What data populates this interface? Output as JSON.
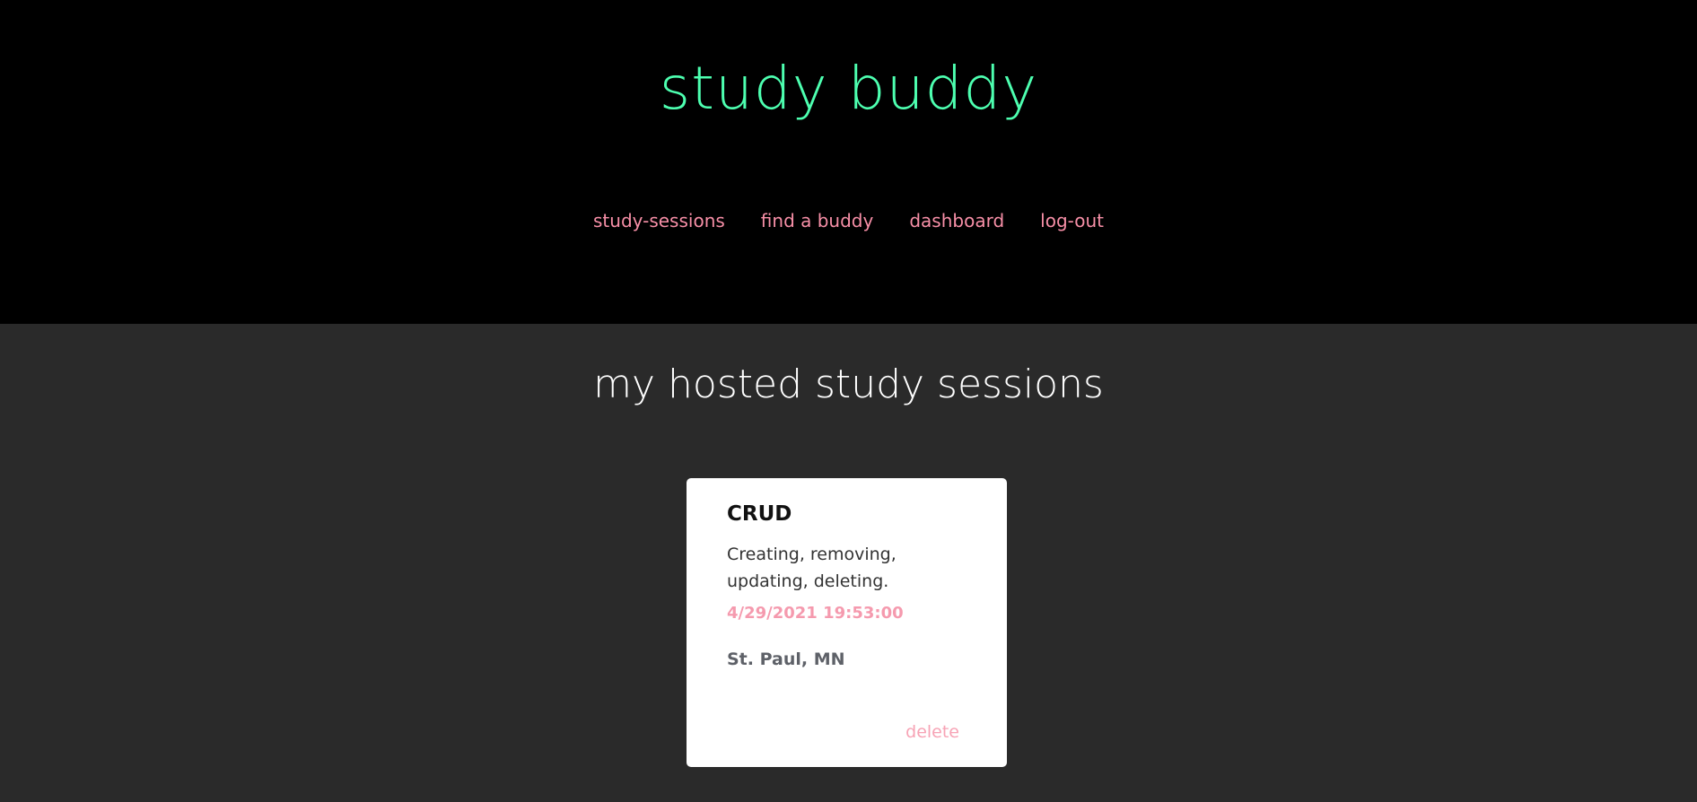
{
  "header": {
    "brand": "study buddy",
    "nav": [
      {
        "label": "study-sessions"
      },
      {
        "label": "find a buddy"
      },
      {
        "label": "dashboard"
      },
      {
        "label": "log-out"
      }
    ]
  },
  "main": {
    "section_title": "my hosted study sessions",
    "sessions": [
      {
        "title": "CRUD",
        "description": "Creating, removing, updating, deleting.",
        "datetime": "4/29/2021 19:53:00",
        "location": "St. Paul, MN",
        "delete_label": "delete"
      }
    ]
  },
  "colors": {
    "brand": "#4dffb0",
    "nav_link": "#f78fa7",
    "header_bg": "#000000",
    "page_bg": "#2a2a2a"
  }
}
